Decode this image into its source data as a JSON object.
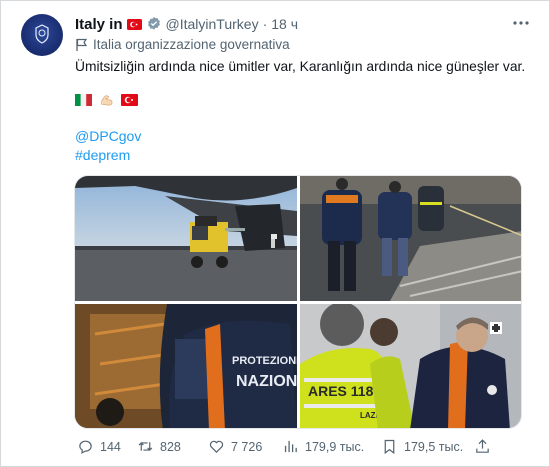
{
  "tweet": {
    "author_name": "Italy in",
    "handle": "@ItalyinTurkey",
    "separator": "·",
    "time": "18 ч",
    "affiliation": "Italia organizzazione governativa",
    "text": "Ümitsizliğin ardında nice ümitler var, Karanlığın ardında nice güneşler var.",
    "emoji_flags": [
      "italy-flag",
      "flexed-biceps",
      "turkey-flag"
    ],
    "links": [
      "@DPCgov",
      "#deprem"
    ],
    "media_text": {
      "vest_1": "PROTEZIONE",
      "vest_2": "NAZION",
      "vest_3": "ARES 118",
      "vest_4": "LAZIO"
    }
  },
  "actions": {
    "replies": "144",
    "retweets": "828",
    "likes": "7 726",
    "views": "179,9 тыс.",
    "bookmarks": "179,5 тыс."
  },
  "colors": {
    "link": "#1d9bf0",
    "secondary_text": "#536471",
    "verified": "#829aab",
    "avatar": "#1b2f73"
  },
  "icons": [
    "more-icon",
    "verified-icon",
    "affiliation-flag-icon",
    "reply-icon",
    "retweet-icon",
    "like-icon",
    "views-icon",
    "bookmark-icon",
    "share-icon"
  ]
}
